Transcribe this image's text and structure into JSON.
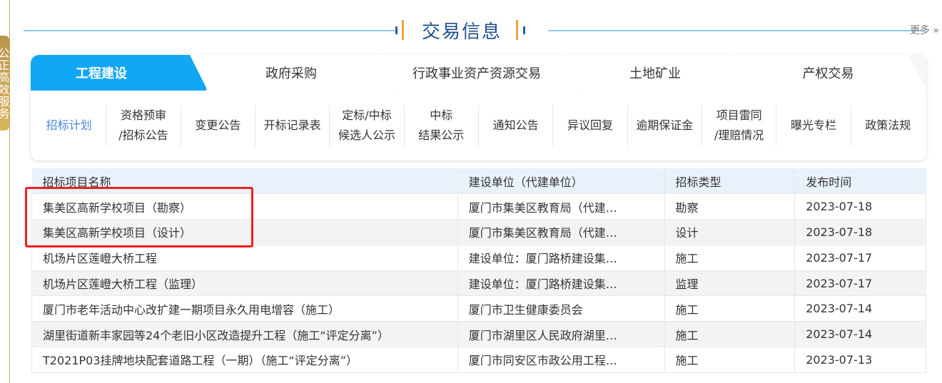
{
  "side_tab": {
    "label": "公正高效服务"
  },
  "header": {
    "title": "交易信息",
    "more": "更多 »"
  },
  "tabs": [
    {
      "label": "工程建设",
      "active": true
    },
    {
      "label": "政府采购"
    },
    {
      "label": "行政事业资产资源交易"
    },
    {
      "label": "土地矿业"
    },
    {
      "label": "产权交易"
    }
  ],
  "subnav": [
    [
      "招标计划"
    ],
    [
      "资格预审",
      "/招标公告"
    ],
    [
      "变更公告"
    ],
    [
      "开标记录表"
    ],
    [
      "定标/中标",
      "候选人公示"
    ],
    [
      "中标",
      "结果公示"
    ],
    [
      "通知公告"
    ],
    [
      "异议回复"
    ],
    [
      "逾期保证金"
    ],
    [
      "项目雷同",
      "/理赔情况"
    ],
    [
      "曝光专栏"
    ],
    [
      "政策法规"
    ]
  ],
  "table": {
    "headers": [
      "招标项目名称",
      "建设单位（代建单位）",
      "招标类型",
      "发布时间"
    ],
    "rows": [
      [
        "集美区高新学校项目（勘察）",
        "厦门市集美区教育局（代建…",
        "勘察",
        "2023-07-18"
      ],
      [
        "集美区高新学校项目（设计）",
        "厦门市集美区教育局（代建…",
        "设计",
        "2023-07-18"
      ],
      [
        "机场片区莲嶝大桥工程",
        "建设单位：厦门路桥建设集…",
        "施工",
        "2023-07-17"
      ],
      [
        "机场片区莲嶝大桥工程（监理）",
        "建设单位：厦门路桥建设集…",
        "监理",
        "2023-07-17"
      ],
      [
        "厦门市老年活动中心改扩建一期项目永久用电增容（施工）",
        "厦门市卫生健康委员会",
        "施工",
        "2023-07-14"
      ],
      [
        "湖里街道新丰家园等24个老旧小区改造提升工程（施工“评定分离”）",
        "厦门市湖里区人民政府湖里…",
        "施工",
        "2023-07-14"
      ],
      [
        "T2021P03挂牌地块配套道路工程（一期）（施工“评定分离”）",
        "厦门市同安区市政公用工程…",
        "施工",
        "2023-07-13"
      ]
    ]
  },
  "colors": {
    "accent": "#12a7f4",
    "highlight": "#f02020",
    "title": "#1f4f8e"
  }
}
